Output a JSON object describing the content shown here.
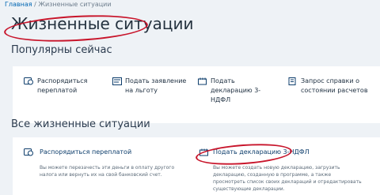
{
  "breadcrumb": {
    "home": "Главная",
    "separator": "/",
    "current": "Жизненные ситуации"
  },
  "page_title": "Жизненные ситуации",
  "popular": {
    "heading": "Популярны сейчас",
    "items": [
      {
        "label": "Распорядиться переплатой",
        "icon": "coin-icon"
      },
      {
        "label": "Подать заявление на льготу",
        "icon": "document-icon"
      },
      {
        "label": "Подать декларацию 3-НДФЛ",
        "icon": "declaration-icon"
      },
      {
        "label": "Запрос справки о состоянии расчетов",
        "icon": "certificate-icon"
      }
    ]
  },
  "all": {
    "heading": "Все жизненные ситуации",
    "cards": [
      {
        "title": "Распорядиться переплатой",
        "description": "Вы можете перезачесть эти деньги в оплату другого налога или вернуть их на свой банковский счет.",
        "icon": "coin-icon"
      },
      {
        "title": "Подать декларацию 3-НДФЛ",
        "description": "Вы можете создать новую декларацию, загрузить декларацию, созданную в программе, а также просмотреть список своих деклараций и отредактировать существующие декларации.",
        "icon": "declaration-icon"
      }
    ]
  },
  "colors": {
    "background": "#eef2f6",
    "panel": "#ffffff",
    "link": "#0066b3",
    "annotation": "#c8152b"
  }
}
